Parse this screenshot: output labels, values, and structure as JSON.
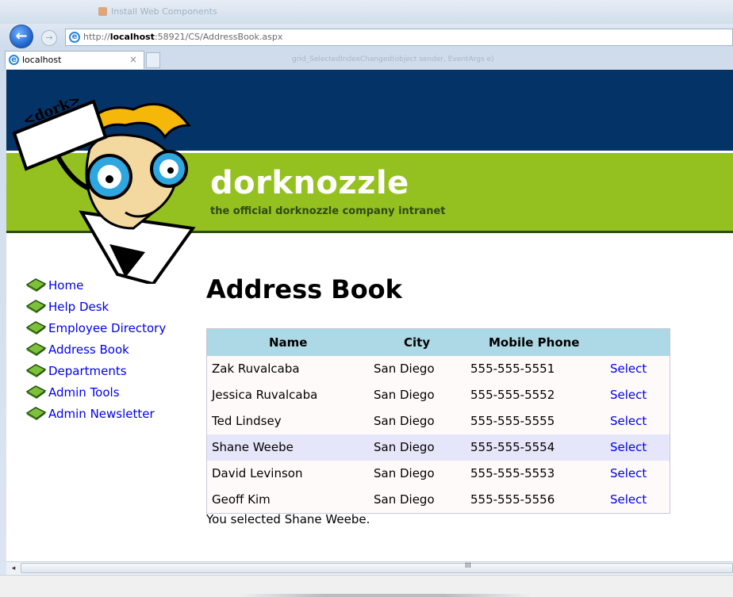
{
  "browser": {
    "faint_title": "Install Web Components",
    "url_prefix": "http://",
    "url_host": "localhost",
    "url_rest": ":58921/CS/AddressBook.aspx",
    "tab_label": "localhost",
    "tab_close": "×",
    "status_hint": "grid_SelectedIndexChanged(object sender, EventArgs e)",
    "back_glyph": "←",
    "forward_glyph": "→",
    "scroll_left_glyph": "◂",
    "scroll_grip": "III"
  },
  "site": {
    "title": "dorknozzle",
    "subtitle": "the official dorknozzle company intranet",
    "mascot_sign": "<dork>"
  },
  "nav": {
    "items": [
      {
        "label": "Home"
      },
      {
        "label": "Help Desk"
      },
      {
        "label": "Employee Directory"
      },
      {
        "label": "Address Book"
      },
      {
        "label": "Departments"
      },
      {
        "label": "Admin Tools"
      },
      {
        "label": "Admin Newsletter"
      }
    ]
  },
  "main": {
    "title": "Address Book",
    "columns": [
      "Name",
      "City",
      "Mobile Phone"
    ],
    "rows": [
      {
        "name": "Zak Ruvalcaba",
        "city": "San Diego",
        "phone": "555-555-5551",
        "action": "Select"
      },
      {
        "name": "Jessica Ruvalcaba",
        "city": "San Diego",
        "phone": "555-555-5552",
        "action": "Select"
      },
      {
        "name": "Ted Lindsey",
        "city": "San Diego",
        "phone": "555-555-5555",
        "action": "Select"
      },
      {
        "name": "Shane Weebe",
        "city": "San Diego",
        "phone": "555-555-5554",
        "action": "Select"
      },
      {
        "name": "David Levinson",
        "city": "San Diego",
        "phone": "555-555-5553",
        "action": "Select"
      },
      {
        "name": "Geoff Kim",
        "city": "San Diego",
        "phone": "555-555-5556",
        "action": "Select"
      }
    ],
    "selected_row": 3,
    "message": "You selected Shane Weebe."
  },
  "colors": {
    "banner_blue": "#043367",
    "banner_green": "#94c11f",
    "header_bg": "#add8e6",
    "selected_row_bg": "#e6e6fa",
    "link": "#0000ee"
  }
}
